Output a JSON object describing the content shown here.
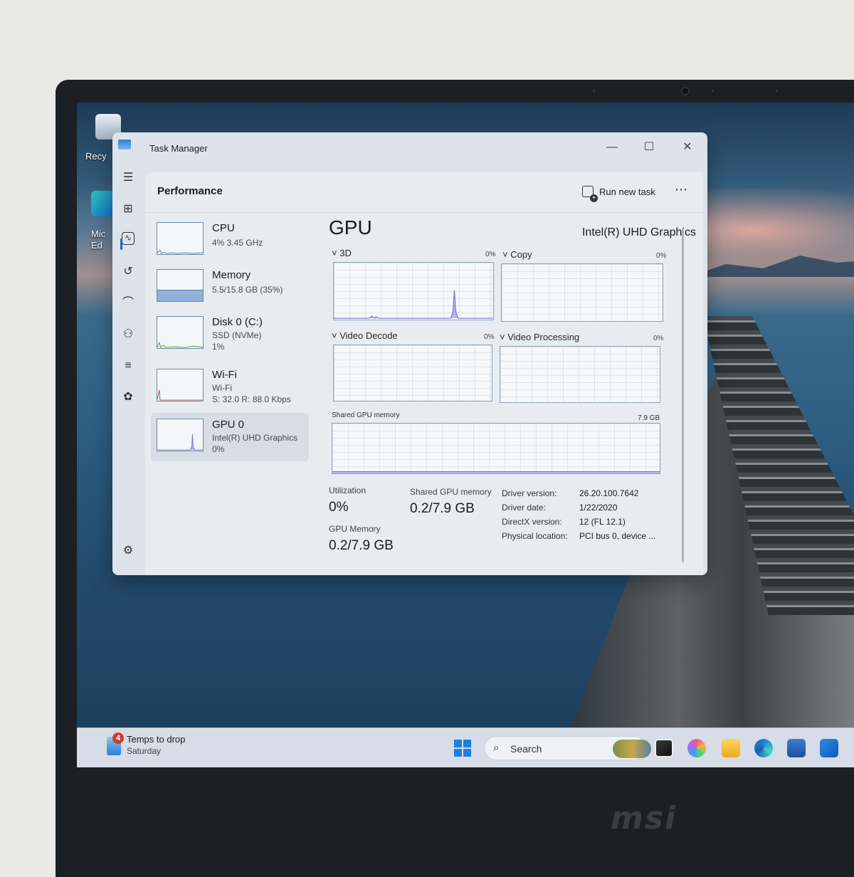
{
  "desktop": {
    "icons": [
      {
        "label": "Recy",
        "icon": "recycle-bin-icon"
      },
      {
        "label": "Mic\nEd",
        "icon": "edge-shortcut-icon"
      }
    ],
    "brand": "msi"
  },
  "window": {
    "title": "Task Manager",
    "controls": {
      "minimize": "—",
      "maximize": "☐",
      "close": "✕"
    }
  },
  "nav": {
    "icons": [
      "hamburger-icon",
      "processes-icon",
      "performance-icon",
      "app-history-icon",
      "startup-apps-icon",
      "users-icon",
      "details-icon",
      "services-icon",
      "settings-icon"
    ]
  },
  "header": {
    "title": "Performance",
    "run_new_task": "Run new task",
    "more": "⋯"
  },
  "perf_list": [
    {
      "name": "CPU",
      "sub1": "4% 3.45 GHz",
      "sub2": ""
    },
    {
      "name": "Memory",
      "sub1": "5.5/15.8 GB (35%)",
      "sub2": ""
    },
    {
      "name": "Disk 0 (C:)",
      "sub1": "SSD (NVMe)",
      "sub2": "1%"
    },
    {
      "name": "Wi-Fi",
      "sub1": "Wi-Fi",
      "sub2": "S: 32.0 R: 88.0 Kbps"
    },
    {
      "name": "GPU 0",
      "sub1": "Intel(R) UHD Graphics",
      "sub2": "0%"
    }
  ],
  "gpu": {
    "title": "GPU",
    "model": "Intel(R) UHD Graphics",
    "engines": [
      {
        "label": "3D",
        "pct": "0%"
      },
      {
        "label": "Copy",
        "pct": "0%"
      },
      {
        "label": "Video Decode",
        "pct": "0%"
      },
      {
        "label": "Video Processing",
        "pct": "0%"
      }
    ],
    "shared_label": "Shared GPU memory",
    "shared_max": "7.9 GB",
    "stats": {
      "utilization_label": "Utilization",
      "utilization_value": "0%",
      "shared_label": "Shared GPU memory",
      "shared_value": "0.2/7.9 GB",
      "gpu_memory_label": "GPU Memory",
      "gpu_memory_value": "0.2/7.9 GB"
    },
    "info": [
      {
        "label": "Driver version:",
        "value": "26.20.100.7642"
      },
      {
        "label": "Driver date:",
        "value": "1/22/2020"
      },
      {
        "label": "DirectX version:",
        "value": "12 (FL 12.1)"
      },
      {
        "label": "Physical location:",
        "value": "PCI bus 0, device ..."
      }
    ]
  },
  "taskbar": {
    "weather_badge": "4",
    "weather_line1": "Temps to drop",
    "weather_line2": "Saturday",
    "search_label": "Search",
    "search_icon": "⌕"
  },
  "colors": {
    "accent": "#1468c8",
    "graph_line": "#7c73d8",
    "graph_fill": "#b7b2ee",
    "memory_fill": "#8fb2d6"
  }
}
